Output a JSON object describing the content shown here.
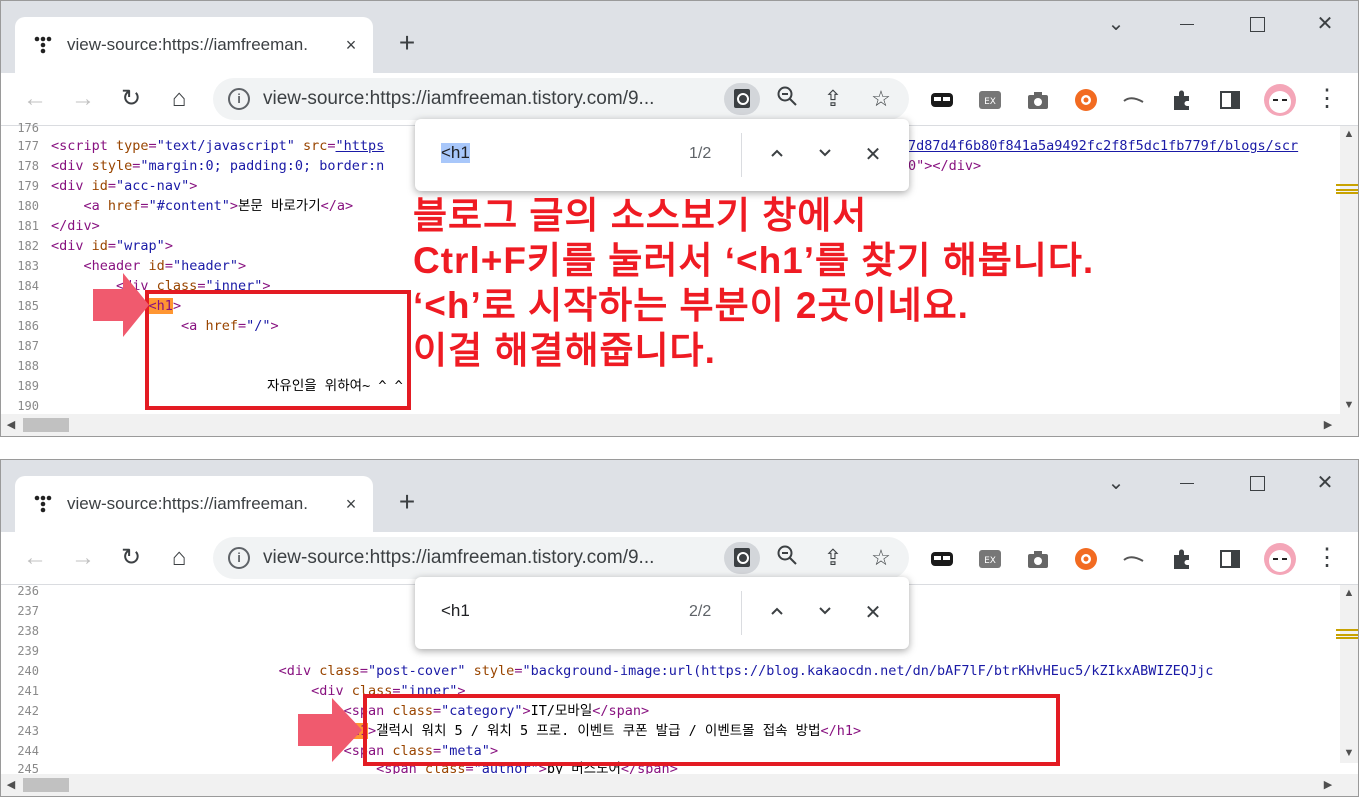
{
  "windows": [
    {
      "tab_title": "view-source:https://iamfreeman.",
      "url": "view-source:https://iamfreeman.tistory.com/9...",
      "find": {
        "query": "<h1",
        "count": "1/2"
      }
    },
    {
      "tab_title": "view-source:https://iamfreeman.",
      "url": "view-source:https://iamfreeman.tistory.com/9...",
      "find": {
        "query": "<h1",
        "count": "2/2"
      }
    }
  ],
  "icons": {
    "tab_close": "×",
    "new_tab": "+",
    "minimize": "⌄",
    "maximize": "☐",
    "close": "✕",
    "back": "←",
    "forward": "→",
    "reload": "↻",
    "home": "⌂",
    "info": "i",
    "zoom": "🔍︎",
    "share": "⇪",
    "star": "☆",
    "find_up": "⌃",
    "find_down": "⌄",
    "find_close": "✕",
    "menu": "⋮"
  },
  "code1": {
    "l176": {
      "n": "176"
    },
    "l177": {
      "n": "177",
      "t1": "<script ",
      "a1": "type",
      "eq1": "=",
      "v1": "\"text/javascript\"",
      "a2": " src",
      "eq2": "=",
      "v2": "\"https",
      "tail": "7d87d4f6b80f841a5a9492fc2f8f5dc1fb779f/blogs/scr"
    },
    "l178": {
      "n": "178",
      "t1": "<div ",
      "a1": "style",
      "eq1": "=",
      "v1": "\"margin:0; padding:0; border:n",
      "tail": "0\"></div>"
    },
    "l179": {
      "n": "179",
      "t1": "<div ",
      "a1": "id",
      "eq1": "=",
      "v1": "\"acc-nav\"",
      "t2": ">"
    },
    "l180": {
      "n": "180",
      "ind": "    ",
      "t1": "<a ",
      "a1": "href",
      "eq1": "=",
      "v1": "\"#content\"",
      "t2": ">",
      "txt": "본문 바로가기",
      "t3": "</a>"
    },
    "l181": {
      "n": "181",
      "t1": "</div>"
    },
    "l182": {
      "n": "182",
      "t1": "<div ",
      "a1": "id",
      "eq1": "=",
      "v1": "\"wrap\"",
      "t2": ">"
    },
    "l183": {
      "n": "183",
      "ind": "    ",
      "t1": "<header ",
      "a1": "id",
      "eq1": "=",
      "v1": "\"header\"",
      "t2": ">"
    },
    "l184": {
      "n": "184",
      "ind": "        ",
      "t1": "<div ",
      "a1": "class",
      "eq1": "=",
      "v1": "\"inner\"",
      "t2": ">"
    },
    "l185": {
      "n": "185",
      "ind": "            ",
      "hl": "<h1",
      "t2": ">"
    },
    "l186": {
      "n": "186",
      "ind": "                ",
      "t1": "<a ",
      "a1": "href",
      "eq1": "=",
      "v1": "\"/\"",
      "t2": ">"
    },
    "l187": {
      "n": "187"
    },
    "l188": {
      "n": "188"
    },
    "l189": {
      "n": "189",
      "txt": "자유인을 위하여~ ^ ^"
    },
    "l190": {
      "n": "190"
    }
  },
  "code2": {
    "l236": {
      "n": "236"
    },
    "l237": {
      "n": "237"
    },
    "l238": {
      "n": "238"
    },
    "l239": {
      "n": "239"
    },
    "l240": {
      "n": "240",
      "ind": "                            ",
      "t1": "<div ",
      "a1": "class",
      "eq1": "=",
      "v1": "\"post-cover\"",
      "a2": " style",
      "eq2": "=",
      "v2": "\"background-image:url(https://blog.kakaocdn.net/dn/bAF7lF/btrKHvHEuc5/kZIkxABWIZEQJjc"
    },
    "l241": {
      "n": "241",
      "ind": "                                ",
      "t1": "<div ",
      "a1": "class",
      "eq1": "=",
      "v1": "\"inner\"",
      "t2": ">"
    },
    "l242": {
      "n": "242",
      "ind": "                                    ",
      "t1": "<span ",
      "a1": "class",
      "eq1": "=",
      "v1": "\"category\"",
      "t2": ">",
      "txt": "IT/모바일",
      "t3": "</span>"
    },
    "l243": {
      "n": "243",
      "ind": "                                    ",
      "hl": "<h1",
      "t2": ">",
      "txt": "갤럭시 워치 5 / 워치 5 프로. 이벤트 쿠폰 발급 / 이벤트몰 접속 방법",
      "t3": "</h1>"
    },
    "l244": {
      "n": "244",
      "ind": "                                    ",
      "t1": "<span ",
      "a1": "class",
      "eq1": "=",
      "v1": "\"meta\"",
      "t2": ">"
    },
    "l245": {
      "n": "245",
      "ind": "                                        ",
      "t1": "<span ",
      "a1": "class",
      "eq1": "=",
      "v1": "\"author\"",
      "t2": ">",
      "txt": "by 버스노어",
      "t3": "</span>"
    }
  },
  "annotation": {
    "line1": "블로그 글의 소스보기 창에서",
    "line2": "Ctrl+F키를 눌러서 ‘<h1’를 찾기 해봅니다.",
    "line3": "‘<h’로 시작하는 부분이 2곳이네요.",
    "line4": "이걸 해결해줍니다."
  },
  "colors": {
    "annotation": "#ef1b23",
    "highlight": "#ff9632",
    "tag": "#881280",
    "attr": "#994500",
    "value": "#1a1aa6"
  }
}
